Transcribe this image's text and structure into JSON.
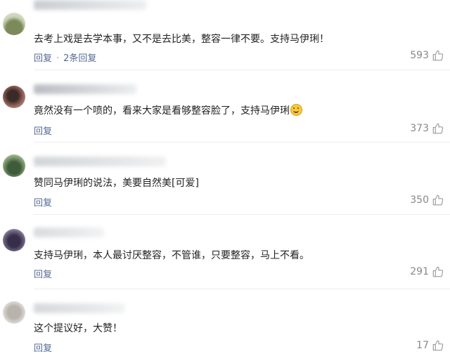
{
  "colors": {
    "link": "#576b95",
    "text": "#222222",
    "meta": "#888888",
    "divider": "#ededed"
  },
  "icons": {
    "like": "thumbs-up-icon",
    "emoji": "smile-emoji"
  },
  "comments": [
    {
      "text": "去考上戏是去学本事，又不是去比美，整容一律不要。支持马伊琍！",
      "reply": "回复",
      "sub_replies": "2条回复",
      "likes": "593"
    },
    {
      "text": "竟然没有一个喷的，看来大家是看够整容脸了，支持马伊琍",
      "reply": "回复",
      "likes": "373"
    },
    {
      "text": "赞同马伊琍的说法，美要自然美[可爱]",
      "reply": "回复",
      "likes": "350"
    },
    {
      "text": "支持马伊琍，本人最讨厌整容，不管谁，只要整容，马上不看。",
      "reply": "回复",
      "likes": "291"
    },
    {
      "text": "这个提议好，大赞！",
      "reply": "回复",
      "likes": "17"
    }
  ]
}
